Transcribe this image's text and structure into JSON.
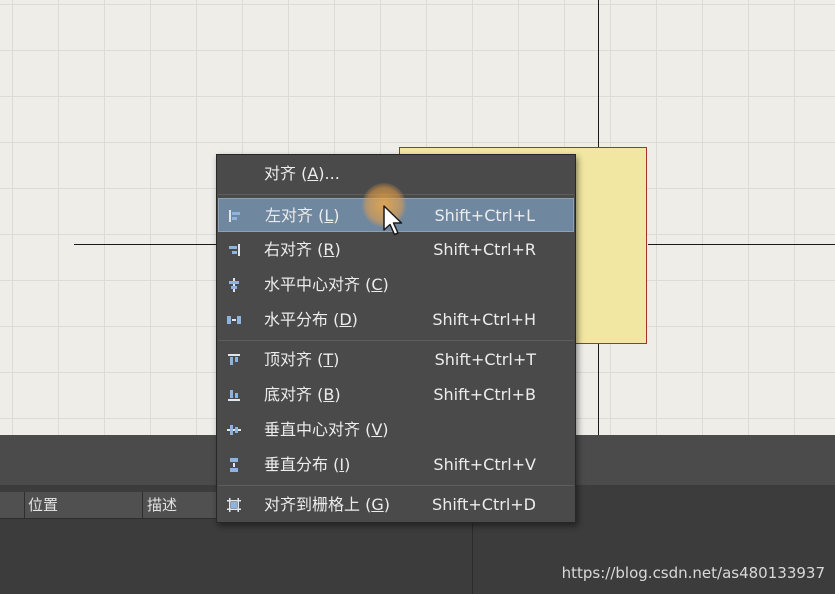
{
  "table_header": {
    "columns": [
      "位置",
      "描述"
    ]
  },
  "context_menu": {
    "items": [
      {
        "label": "对齐 (",
        "key": "A",
        "suffix": ")...",
        "shortcut": "",
        "icon": "none"
      },
      {
        "label": "左对齐 (",
        "key": "L",
        "suffix": ")",
        "shortcut": "Shift+Ctrl+L",
        "icon": "align-left-icon",
        "highlighted": true
      },
      {
        "label": "右对齐 (",
        "key": "R",
        "suffix": ")",
        "shortcut": "Shift+Ctrl+R",
        "icon": "align-right-icon"
      },
      {
        "label": "水平中心对齐 (",
        "key": "C",
        "suffix": ")",
        "shortcut": "",
        "icon": "align-horizontal-center-icon"
      },
      {
        "label": "水平分布 (",
        "key": "D",
        "suffix": ")",
        "shortcut": "Shift+Ctrl+H",
        "icon": "distribute-horizontal-icon"
      },
      {
        "label": "顶对齐 (",
        "key": "T",
        "suffix": ")",
        "shortcut": "Shift+Ctrl+T",
        "icon": "align-top-icon"
      },
      {
        "label": "底对齐 (",
        "key": "B",
        "suffix": ")",
        "shortcut": "Shift+Ctrl+B",
        "icon": "align-bottom-icon"
      },
      {
        "label": "垂直中心对齐 (",
        "key": "V",
        "suffix": ")",
        "shortcut": "",
        "icon": "align-vertical-center-icon"
      },
      {
        "label": "垂直分布 (",
        "key": "I",
        "suffix": ")",
        "shortcut": "Shift+Ctrl+V",
        "icon": "distribute-vertical-icon"
      },
      {
        "label": "对齐到栅格上 (",
        "key": "G",
        "suffix": ")",
        "shortcut": "Shift+Ctrl+D",
        "icon": "align-to-grid-icon"
      }
    ]
  },
  "colors": {
    "menu_bg": "#4a4a4a",
    "menu_highlight": "#6f879f",
    "component_fill": "#f1e7a2",
    "component_border": "#a3342b",
    "icon_blue": "#8cb4de"
  },
  "watermark": "https://blog.csdn.net/as480133937"
}
